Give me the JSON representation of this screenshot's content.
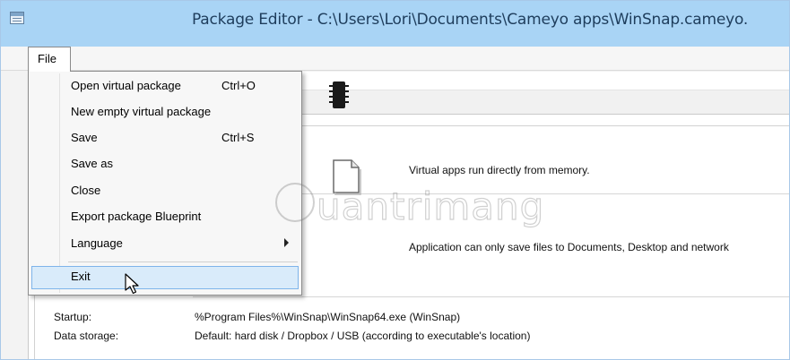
{
  "window": {
    "title": "Package Editor - C:\\Users\\Lori\\Documents\\Cameyo apps\\WinSnap.cameyo.",
    "app_icon": "package-editor-icon"
  },
  "menubar": {
    "file_label": "File"
  },
  "file_menu": {
    "items": [
      {
        "label": "Open virtual package",
        "shortcut": "Ctrl+O"
      },
      {
        "label": "New empty virtual package",
        "shortcut": ""
      },
      {
        "label": "Save",
        "shortcut": "Ctrl+S"
      },
      {
        "label": "Save as",
        "shortcut": ""
      },
      {
        "label": "Close",
        "shortcut": ""
      },
      {
        "label": "Export package Blueprint",
        "shortcut": ""
      },
      {
        "label": "Language",
        "shortcut": "",
        "submenu": true
      },
      {
        "label": "Exit",
        "shortcut": "",
        "highlighted": true
      }
    ]
  },
  "info": {
    "memory_text": "Virtual apps run directly from memory.",
    "save_text": "Application can only save files to Documents, Desktop and network"
  },
  "properties": {
    "startup_label": "Startup:",
    "startup_value": "%Program Files%\\WinSnap\\WinSnap64.exe (WinSnap)",
    "storage_label": "Data storage:",
    "storage_value": "Default: hard disk / Dropbox / USB (according to executable's location)"
  },
  "watermark": {
    "text": "uantrimang"
  },
  "colors": {
    "titlebar": "#a9d4f5",
    "menu_highlight": "#d9ebfa",
    "menu_highlight_border": "#7eb4ea"
  }
}
